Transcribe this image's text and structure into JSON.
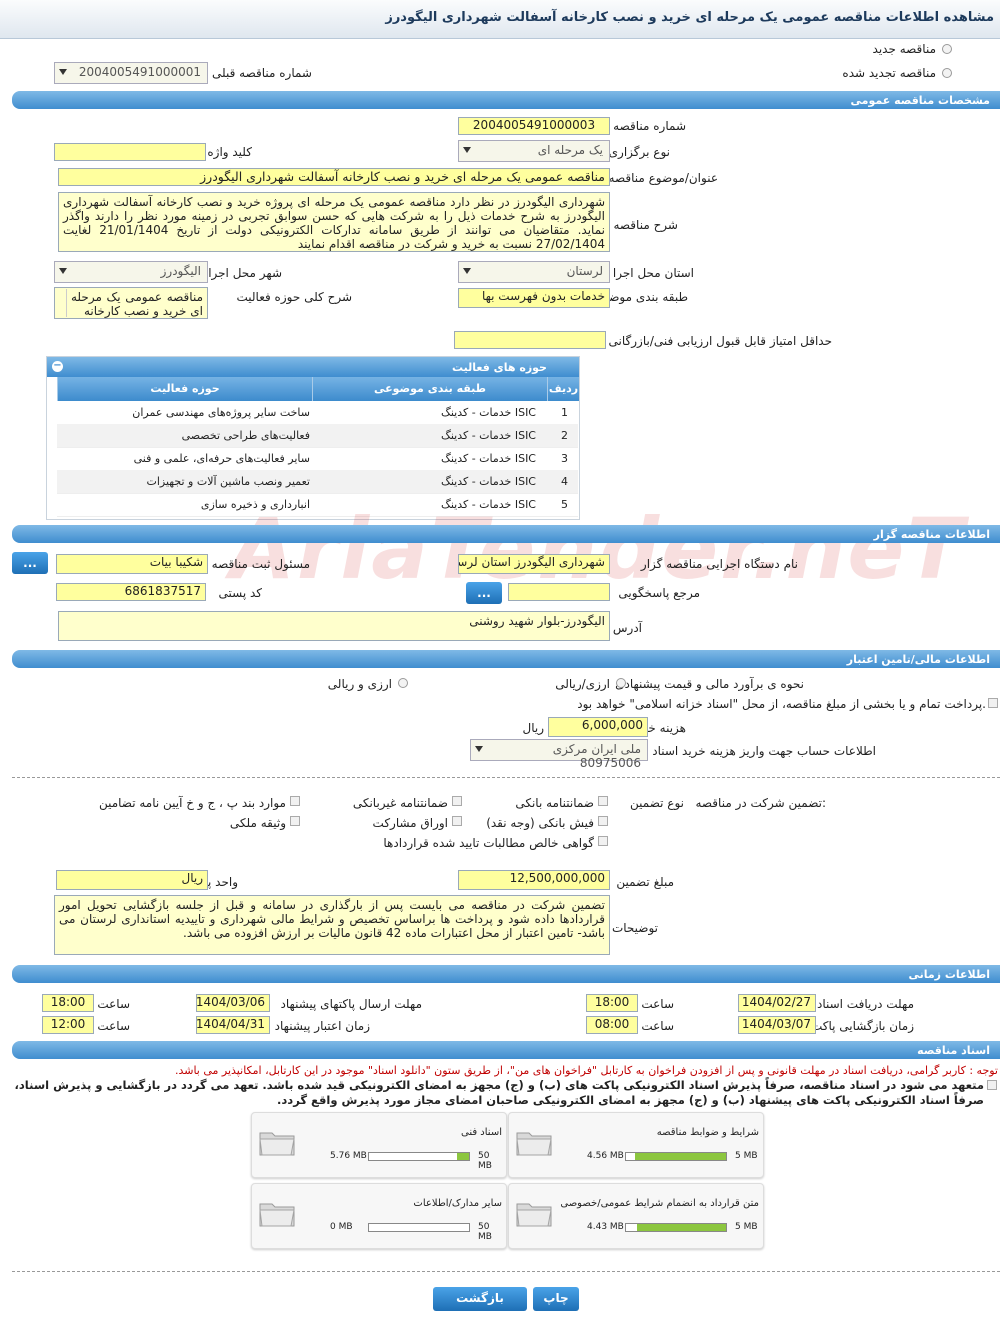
{
  "page_title": "مشاهده اطلاعات مناقصه عمومی یک مرحله ای خرید و نصب کارخانه آسفالت شهرداری الیگودرز",
  "top": {
    "new_tender": "مناقصه جدید",
    "renewed_tender": "مناقصه تجدید شده",
    "prev_tender_label": "شماره مناقصه قبلی",
    "prev_tender_value": "2004005491000001"
  },
  "general": {
    "header": "مشخصات مناقصه عمومی",
    "number_label": "شماره مناقصه",
    "number_value": "2004005491000003",
    "type_label": "نوع برگزاری",
    "type_value": "یک مرحله ای",
    "keyword_label": "کلید واژه",
    "keyword_value": "",
    "subject_label": "عنوان/موضوع مناقصه",
    "subject_value": "مناقصه عمومی یک مرحله ای خرید و نصب کارخانه آسفالت شهرداری الیگودرز",
    "desc_label": "شرح مناقصه",
    "desc_value": "شهرداری الیگودرز در نظر دارد مناقصه عمومی یک مرحله ای پروژه خرید و نصب کارخانه آسفالت شهرداری الیگودرز به شرح خدمات ذیل را به شرکت هایی که حسن سوابق تجربی در زمینه مورد نظر را دارند واگذر نماید. متقاضیان می توانند از طریق سامانه تدارکات الکترونیکی دولت از تاریخ 21/01/1404 لغایت 27/02/1404 نسبت به خرید و شرکت در مناقصه اقدام نمایند",
    "province_label": "استان محل اجرا",
    "province_value": "لرستان",
    "city_label": "شهر محل اجرا",
    "city_value": "الیگودرز",
    "category_label": "طبقه بندی موضوعی",
    "category_value": "خدمات بدون فهرست بها",
    "scope_label": "شرح کلی حوزه فعالیت",
    "scope_value": "مناقصه عمومی یک مرحله ای خرید و نصب کارخانه",
    "min_score_label": "حداقل امتیاز قابل قبول ارزیابی فنی/بازرگانی",
    "min_score_value": ""
  },
  "activity_grid": {
    "title": "حوزه های فعالیت",
    "col_row": "ردیف",
    "col_category": "طبقه بندی موضوعی",
    "col_field": "حوزه فعالیت",
    "rows": [
      {
        "n": "1",
        "cat": "خدمات - کدینگ ISIC",
        "field": "ساخت سایر پروژه‌های مهندسی عمران"
      },
      {
        "n": "2",
        "cat": "خدمات - کدینگ ISIC",
        "field": "فعالیت‌های طراحی تخصصی"
      },
      {
        "n": "3",
        "cat": "خدمات - کدینگ ISIC",
        "field": "سایر فعالیت‌های حرفه‌ای، علمی و فنی"
      },
      {
        "n": "4",
        "cat": "خدمات - کدینگ ISIC",
        "field": "تعمیر ونصب ماشین آلات و تجهیزات"
      },
      {
        "n": "5",
        "cat": "خدمات - کدینگ ISIC",
        "field": "انبارداری و ذخیره سازی"
      }
    ]
  },
  "organizer": {
    "header": "اطلاعات مناقصه گزار",
    "org_label": "نام دستگاه اجرایی مناقصه گزار",
    "org_value": "شهرداری الیگودرز استان لرستان",
    "registrar_label": "مسئول ثبت مناقصه",
    "registrar_value": "شکیبا بیات",
    "responder_label": "مرجع پاسخگویی",
    "responder_value": "",
    "postal_label": "کد پستی",
    "postal_value": "6861837517",
    "address_label": "آدرس",
    "address_value": "الیگودرز-بلوار شهید روشنی",
    "more_btn": "...",
    "more_btn2": "..."
  },
  "financial": {
    "header": "اطلاعات مالی/تامین اعتبار",
    "pricing_label": "نحوه ی برآورد مالی و قیمت پیشنهادی",
    "opt_rial": "ارزی/ریالی",
    "opt_fx_rial": "ارزی و ریالی",
    "islamic_note": "پرداخت تمام و یا بخشی از مبلغ مناقصه، از محل \"اسناد خزانه اسلامی\" خواهد بود.",
    "fee_label": "هزینه خرید اسناد",
    "fee_value": "6,000,000",
    "fee_unit": "ریال",
    "account_label": "اطلاعات حساب جهت واریز هزینه خرید اسناد",
    "account_value": "ملی ایران مرکزی 80975006"
  },
  "guarantee": {
    "participation_label": "تضمین شرکت در مناقصه:",
    "type_label": "نوع تضمین",
    "options": {
      "bank_guarantee": "ضمانتنامه بانکی",
      "non_bank_guarantee": "ضمانتنامه غیربانکی",
      "article_items": "موارد بند پ ، ج و خ آیین نامه تضامین",
      "bank_receipt": "فیش بانکی (وجه نقد)",
      "participation_bonds": "اوراق مشارکت",
      "property_deed": "وثیقه ملکی",
      "net_claims": "گواهی خالص مطالبات تایید شده قراردادها"
    },
    "amount_label": "مبلغ تضمین",
    "amount_value": "12,500,000,000",
    "currency_label": "واحد پول",
    "currency_value": "ریال",
    "notes_label": "توضیحات",
    "notes_value": "تضمین شرکت در مناقصه می بایست پس از بارگذاری در سامانه و قبل از جلسه بازگشایی تحویل امور قراردادها داده شود و پرداخت ها براساس تخصیص و شرایط مالی شهرداری و تاییدیه استانداری لرستان می باشد- تامین اعتبار از محل اعتبارات ماده 42 قانون مالیات بر ارزش افزوده می باشد."
  },
  "timing": {
    "header": "اطلاعات زمانی",
    "doc_deadline_label": "مهلت دریافت اسناد",
    "doc_deadline_date": "1404/02/27",
    "doc_deadline_time": "18:00",
    "submit_deadline_label": "مهلت ارسال پاکتهای پیشنهاد",
    "submit_deadline_date": "1404/03/06",
    "submit_deadline_time": "18:00",
    "opening_label": "زمان بازگشایی پاکت ها",
    "opening_date": "1404/03/07",
    "opening_time": "08:00",
    "validity_label": "زمان اعتبار پیشنهاد",
    "validity_date": "1404/04/31",
    "validity_time": "12:00",
    "time_label": "ساعت"
  },
  "documents": {
    "header": "اسناد مناقصه",
    "note_red": "توجه : کاربر گرامی، دریافت اسناد در مهلت قانونی و پس از افزودن فراخوان به کارتابل \"فراخوان های من\"، از طریق ستون \"دانلود اسناد\" موجود در این کارتابل، امکانپذیر می باشد.",
    "commitment": "متعهد می شود در اسناد مناقصه، صرفاً پذیرش اسناد الکترونیکی پاکت های (ب) و (ج) مجهز به امضای الکترونیکی قید شده باشد. تعهد می گردد در بازگشایی و پذیرش اسناد، صرفاً اسناد الکترونیکی پاکت های پیشنهاد (ب) و (ج) مجهز به امضای الکترونیکی صاحبان امضای مجاز مورد پذیرش واقع گردد.",
    "files": [
      {
        "name": "شرایط و ضوابط مناقصه",
        "size": "4.56 MB",
        "max": "5 MB",
        "fill": 0.91
      },
      {
        "name": "اسناد فنی",
        "size": "5.76 MB",
        "max": "50 MB",
        "fill": 0.12
      },
      {
        "name": "متن قرارداد به انضمام شرایط عمومی/خصوصی",
        "size": "4.43 MB",
        "max": "5 MB",
        "fill": 0.89
      },
      {
        "name": "سایر مدارک/اطلاعات",
        "size": "0 MB",
        "max": "50 MB",
        "fill": 0
      }
    ]
  },
  "actions": {
    "print": "چاپ",
    "back": "بازگشت"
  },
  "watermark": "AriaTender.neT",
  "colors": {
    "section": "#3f8dcf",
    "field": "#ffff9e",
    "progress": "#8cc63f",
    "note": "#c00000"
  }
}
